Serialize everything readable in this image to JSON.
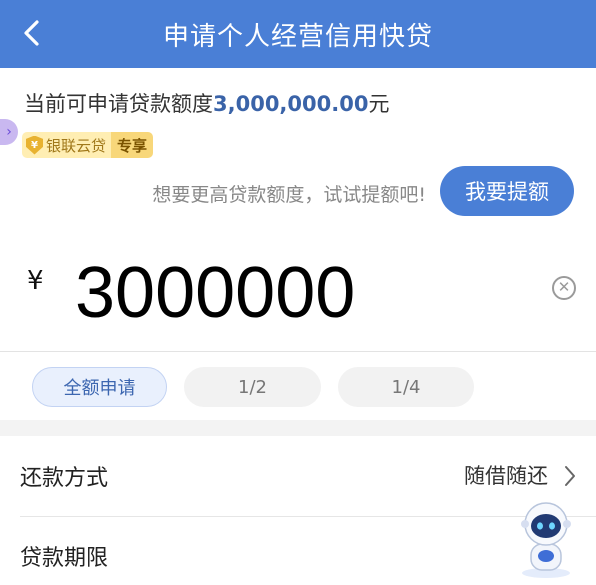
{
  "header": {
    "title": "申请个人经营信用快贷"
  },
  "available": {
    "prefix": "当前可申请贷款额度",
    "amount": "3,000,000.00",
    "suffix": "元"
  },
  "badge": {
    "brand": "银联云贷",
    "tag": "专享"
  },
  "promo": {
    "hint": "想要更高贷款额度，试试提额吧!",
    "button": "我要提额"
  },
  "amount_field": {
    "currency": "¥",
    "value": "3000000"
  },
  "chips": [
    {
      "label": "全额申请",
      "active": true
    },
    {
      "label": "1/2",
      "active": false
    },
    {
      "label": "1/4",
      "active": false
    }
  ],
  "rows": [
    {
      "label": "还款方式",
      "value": "随借随还"
    },
    {
      "label": "贷款期限",
      "value": ""
    }
  ],
  "colors": {
    "brand_blue": "#4a7fd6",
    "amount_blue": "#3a63a8",
    "badge_gold": "#f8d77a"
  },
  "icons": {
    "back": "chevron-left-icon",
    "clear": "clear-circle-icon",
    "row_arrow": "chevron-right-icon",
    "badge": "shield-icon",
    "mascot": "robot-mascot-icon"
  }
}
